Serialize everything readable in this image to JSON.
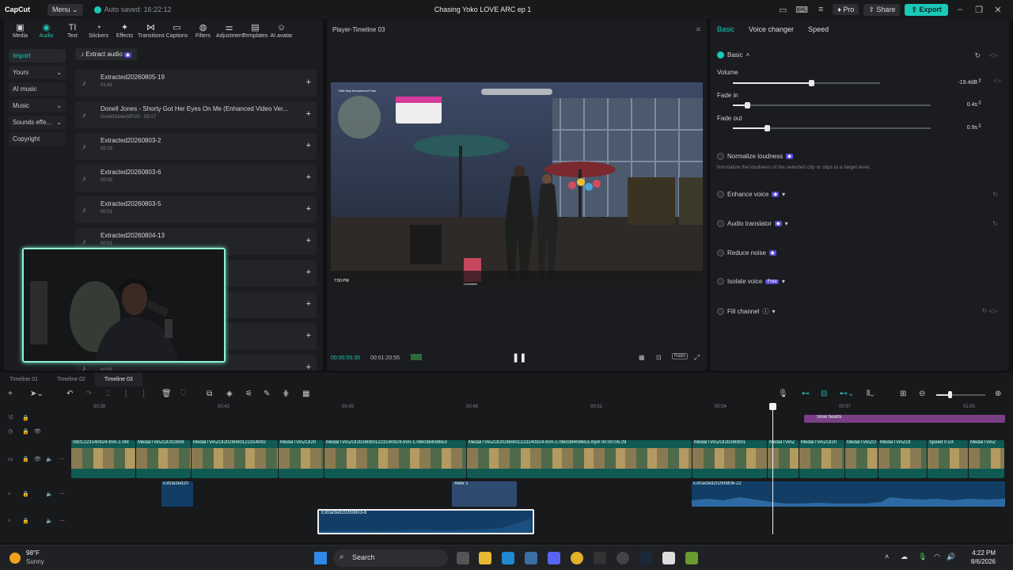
{
  "titlebar": {
    "app_name": "CapCut",
    "menu_label": "Menu",
    "autosave": "Auto saved: 16:22:12",
    "project_title": "Chasing Yoko LOVE ARC ep 1",
    "pro_label": "Pro",
    "share_label": "Share",
    "export_label": "Export"
  },
  "categories": [
    {
      "label": "Media",
      "icon": "media-icon",
      "glyph": "▣"
    },
    {
      "label": "Audio",
      "icon": "audio-icon",
      "glyph": "◉"
    },
    {
      "label": "Text",
      "icon": "text-icon",
      "glyph": "TI"
    },
    {
      "label": "Stickers",
      "icon": "stickers-icon",
      "glyph": "◔"
    },
    {
      "label": "Effects",
      "icon": "effects-icon",
      "glyph": "✦"
    },
    {
      "label": "Transitions",
      "icon": "transitions-icon",
      "glyph": "⋈"
    },
    {
      "label": "Captions",
      "icon": "captions-icon",
      "glyph": "▭"
    },
    {
      "label": "Filters",
      "icon": "filters-icon",
      "glyph": "◍"
    },
    {
      "label": "Adjustment",
      "icon": "adjustment-icon",
      "glyph": "⚌"
    },
    {
      "label": "Templates",
      "icon": "templates-icon",
      "glyph": "▤"
    },
    {
      "label": "AI avatar",
      "icon": "ai-avatar-icon",
      "glyph": "☺"
    }
  ],
  "sidebar": [
    {
      "label": "Import",
      "caret": ""
    },
    {
      "label": "Yours",
      "caret": "⌄"
    },
    {
      "label": "AI music",
      "caret": ""
    },
    {
      "label": "Music",
      "caret": "⌄"
    },
    {
      "label": "Sounds effe...",
      "caret": "⌄"
    },
    {
      "label": "Copyright",
      "caret": ""
    }
  ],
  "extract_audio_label": "Extract audio",
  "audio_items": [
    {
      "title": "Extracted20260805-19",
      "sub": "01:41"
    },
    {
      "title": "Donell Jones - Shorty Got Her Eyes On Me (Enhanced Video Ver...",
      "sub": "DonellJonesVEVO · 03:17"
    },
    {
      "title": "Extracted20260803-2",
      "sub": "00:13"
    },
    {
      "title": "Extracted20260803-6",
      "sub": "00:05"
    },
    {
      "title": "Extracted20260803-5",
      "sub": "00:01"
    },
    {
      "title": "Extracted20260804-13",
      "sub": "00:01"
    },
    {
      "title": "",
      "sub": ""
    },
    {
      "title": "",
      "sub": ""
    },
    {
      "title": "",
      "sub": ""
    },
    {
      "title": "",
      "sub": "00:05"
    }
  ],
  "player": {
    "title": "Player-Timeline 03",
    "current_time": "00:00:55:35",
    "total_time": "00:01:20:55",
    "ratio_label": "Ratio",
    "map_label": "Elite Bay Amusement Park",
    "player_name": "Lovedrah",
    "game_time": "7:50 PM"
  },
  "right_tabs": [
    "Basic",
    "Voice changer",
    "Speed"
  ],
  "basic": {
    "section_label": "Basic",
    "volume_label": "Volume",
    "volume_value": "-19.4dB",
    "volume_level": 0.53,
    "fadein_label": "Fade in",
    "fadein_value": "0.4s",
    "fadein_level": 0.07,
    "fadeout_label": "Fade out",
    "fadeout_value": "0.9s",
    "fadeout_level": 0.17,
    "normalize_label": "Normalize loudness",
    "normalize_desc": "Normalize the loudness of the selected clip or clips to a target level.",
    "enhance_label": "Enhance voice",
    "translator_label": "Audio translator",
    "reduce_label": "Reduce noise",
    "isolate_label": "Isolate voice",
    "isolate_badge": "Free",
    "fill_label": "Fill channel"
  },
  "timeline": {
    "tabs": [
      "Timeline 01",
      "Timeline 02",
      "Timeline 03"
    ],
    "ruler": [
      "00:39",
      "00:42",
      "00:45",
      "00:48",
      "00:51",
      "00:54",
      "00:57",
      "01:00"
    ],
    "video_clip_names": [
      "0801223140924-trim-1788",
      "MedalTVinZOI202608",
      "MedalTVinZOI2026080122314092",
      "MedalTVinZOI20",
      "MedalTVinZOI20260801223140924-trim-1786038408653",
      "MedalTVinZOI20260801223140924-trim-1786038408653.mp4  00:00:05:29",
      "MedalTVinZOI20260801",
      "MedalTVinZ",
      "MedalTVinZOI20",
      "MedalTVinZO",
      "MedalTVinZOI",
      "Speed 0.5X",
      "MedalTVinZ"
    ],
    "effect_clip": "Slow hearts",
    "audio_clip_a": "Extracted20",
    "audio_clip_b": "Aww 1",
    "audio_clip_c": "Extracted20260806-22",
    "audio_clip_d": "Extracted20260803-6"
  },
  "taskbar": {
    "weather_temp": "98°F",
    "weather_desc": "Sunny",
    "search_label": "Search",
    "time": "4:22 PM",
    "date": "8/6/2026"
  },
  "colors": {
    "accent": "#1bc9b8",
    "video_clip": "#0f5a53",
    "audio_clip": "#123e66"
  }
}
